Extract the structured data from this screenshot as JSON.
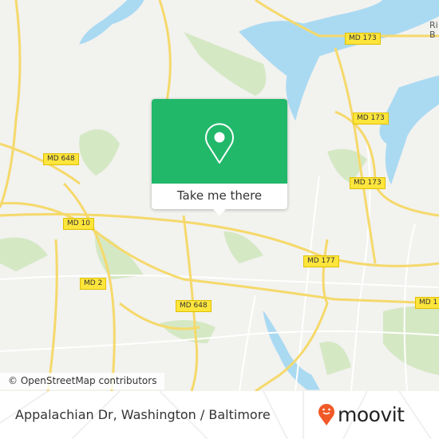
{
  "map": {
    "shields": [
      "MD 173",
      "MD 173",
      "MD 173",
      "MD 648",
      "MD 648",
      "MD 10",
      "MD 177",
      "MD 2",
      "MD 1"
    ],
    "place_partial": [
      "Ri",
      "B"
    ],
    "colors": {
      "land": "#f2f2ef",
      "water": "#aadaf2",
      "park": "#d5e8c4",
      "highway": "#fde53c",
      "road": "#ffffff"
    }
  },
  "popup": {
    "button_label": "Take me there",
    "icon": "map-pin-icon",
    "color": "#22b86a"
  },
  "attribution": "© OpenStreetMap contributors",
  "footer": {
    "title": "Appalachian Dr, Washington / Baltimore",
    "logo_text": "moovit",
    "logo_color": "#f05a28"
  }
}
